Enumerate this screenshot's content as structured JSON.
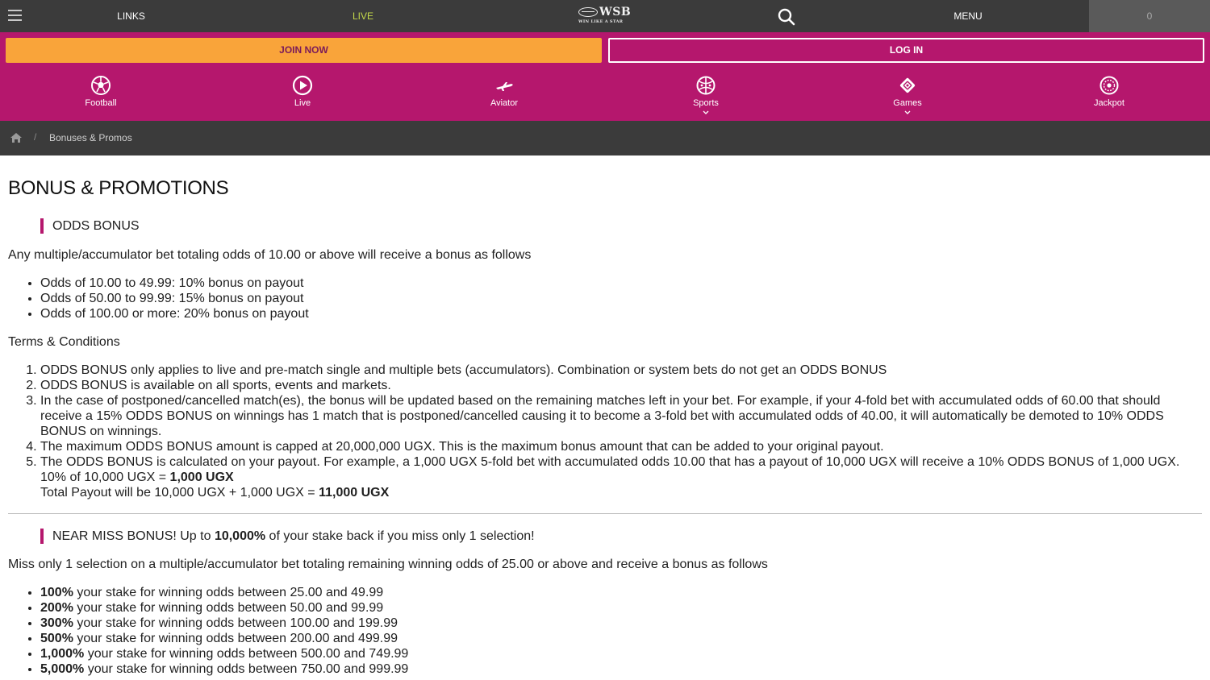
{
  "topbar": {
    "links_label": "LINKS",
    "live_label": "LIVE",
    "logo_text": "WSB",
    "logo_tagline": "WIN LIKE A STAR",
    "menu_label": "MENU",
    "betslip_count": "0"
  },
  "auth": {
    "join_label": "JOIN NOW",
    "login_label": "LOG IN"
  },
  "categories": [
    {
      "label": "Football",
      "icon": "football-icon"
    },
    {
      "label": "Live",
      "icon": "play-icon"
    },
    {
      "label": "Aviator",
      "icon": "airplane-icon"
    },
    {
      "label": "Sports",
      "icon": "sports-icon"
    },
    {
      "label": "Games",
      "icon": "games-icon"
    },
    {
      "label": "Jackpot",
      "icon": "jackpot-icon"
    }
  ],
  "breadcrumb": {
    "separator": "/",
    "current": "Bonuses & Promos"
  },
  "page": {
    "title": "BONUS & PROMOTIONS",
    "odds_bonus": {
      "heading": "ODDS BONUS",
      "intro": "Any multiple/accumulator bet totaling odds of 10.00 or above will receive a bonus as follows",
      "tiers": [
        "Odds of 10.00 to 49.99: 10% bonus on payout",
        "Odds of 50.00 to 99.99: 15% bonus on payout",
        "Odds of 100.00 or more: 20% bonus on payout"
      ],
      "terms_title": "Terms & Conditions",
      "terms": [
        "ODDS BONUS only applies to live and pre-match single and multiple bets (accumulators). Combination or system bets do not get an ODDS BONUS",
        "ODDS BONUS is available on all sports, events and markets.",
        "In the case of postponed/cancelled match(es), the bonus will be updated based on the remaining matches left in your bet. For example, if your 4-fold bet with accumulated odds of 60.00 that should receive a 15% ODDS BONUS on winnings has 1 match that is postponed/cancelled causing it to become a 3-fold bet with accumulated odds of 40.00, it will automatically be demoted to 10% ODDS BONUS on winnings.",
        "The maximum ODDS BONUS amount is capped at 20,000,000 UGX. This is the maximum bonus amount that can be added to your original payout.",
        "The ODDS BONUS is calculated on your payout. For example, a 1,000 UGX 5-fold bet with accumulated odds 10.00 that has a payout of 10,000 UGX will receive a 10% ODDS BONUS of 1,000 UGX."
      ],
      "example_line1_prefix": "10% of 10,000 UGX = ",
      "example_line1_bold": "1,000 UGX",
      "example_line2_prefix": "Total Payout will be 10,000 UGX + 1,000 UGX = ",
      "example_line2_bold": "11,000 UGX"
    },
    "near_miss": {
      "heading_prefix": "NEAR MISS BONUS! Up to ",
      "heading_bold": "10,000%",
      "heading_suffix": " of your stake back if you miss only 1 selection!",
      "intro": "Miss only 1 selection on a multiple/accumulator bet totaling remaining winning odds of 25.00 or above and receive a bonus as follows",
      "tiers": [
        {
          "pct": "100%",
          "text": " your stake for winning odds between 25.00 and 49.99"
        },
        {
          "pct": "200%",
          "text": " your stake for winning odds between 50.00 and 99.99"
        },
        {
          "pct": "300%",
          "text": " your stake for winning odds between 100.00 and 199.99"
        },
        {
          "pct": "500%",
          "text": " your stake for winning odds between 200.00 and 499.99"
        },
        {
          "pct": "1,000%",
          "text": " your stake for winning odds between 500.00 and 749.99"
        },
        {
          "pct": "5,000%",
          "text": " your stake for winning odds between 750.00 and 999.99"
        }
      ]
    }
  },
  "colors": {
    "brand_magenta": "#b5176d",
    "join_orange": "#f9a43a",
    "live_green": "#c3d84a",
    "dark_bar": "#3b3b3b"
  }
}
